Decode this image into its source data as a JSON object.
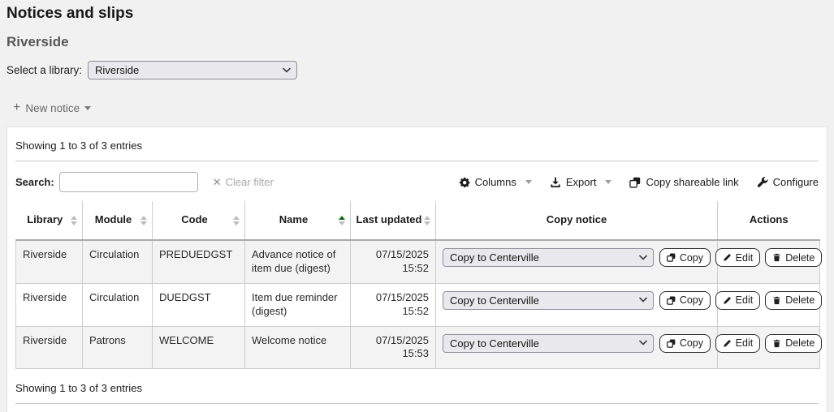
{
  "page": {
    "title": "Notices and slips",
    "library_heading": "Riverside",
    "select_library_label": "Select a library:",
    "library_select_value": "Riverside",
    "new_notice_label": "New notice"
  },
  "panel": {
    "showing_top": "Showing 1 to 3 of 3 entries",
    "showing_bottom": "Showing 1 to 3 of 3 entries",
    "search_label": "Search:",
    "search_value": "",
    "clear_filter_label": "Clear filter",
    "toolbar": {
      "columns_label": "Columns",
      "export_label": "Export",
      "copy_link_label": "Copy shareable link",
      "configure_label": "Configure"
    }
  },
  "table": {
    "columns": [
      {
        "label": "Library",
        "sortable": true,
        "sorted": "none"
      },
      {
        "label": "Module",
        "sortable": true,
        "sorted": "none"
      },
      {
        "label": "Code",
        "sortable": true,
        "sorted": "none"
      },
      {
        "label": "Name",
        "sortable": true,
        "sorted": "asc"
      },
      {
        "label": "Last updated",
        "sortable": true,
        "sorted": "none"
      },
      {
        "label": "Copy notice",
        "sortable": false,
        "sorted": "none"
      },
      {
        "label": "Actions",
        "sortable": false,
        "sorted": "none"
      }
    ],
    "copy_select_value": "Copy to Centerville",
    "actions": {
      "copy": "Copy",
      "edit": "Edit",
      "delete": "Delete"
    },
    "rows": [
      {
        "library": "Riverside",
        "module": "Circulation",
        "code": "PREDUEDGST",
        "name": "Advance notice of item due (digest)",
        "updated_date": "07/15/2025",
        "updated_time": "15:52"
      },
      {
        "library": "Riverside",
        "module": "Circulation",
        "code": "DUEDGST",
        "name": "Item due reminder (digest)",
        "updated_date": "07/15/2025",
        "updated_time": "15:52"
      },
      {
        "library": "Riverside",
        "module": "Patrons",
        "code": "WELCOME",
        "name": "Welcome notice",
        "updated_date": "07/15/2025",
        "updated_time": "15:53"
      }
    ]
  },
  "icons": {
    "columns": "gear-icon",
    "export": "download-icon",
    "copy_link": "copy-icon",
    "configure": "wrench-icon",
    "edit": "pencil-icon",
    "delete": "trash-icon",
    "new_notice": "plus-icon",
    "clear_filter": "x-icon",
    "sort": "sort-arrows-icon",
    "select": "chevron-down-icon"
  },
  "colors": {
    "sort_active_green": "#0b6e14",
    "page_background": "#f1f1f1",
    "panel_background": "#ffffff",
    "select_background": "#e9e9ed",
    "select_border": "#8f8f9d",
    "muted_text": "#6a6a6a",
    "disabled_text": "#aaaaaa",
    "row_stripe": "#f3f3f3",
    "table_border": "#cccccc"
  }
}
